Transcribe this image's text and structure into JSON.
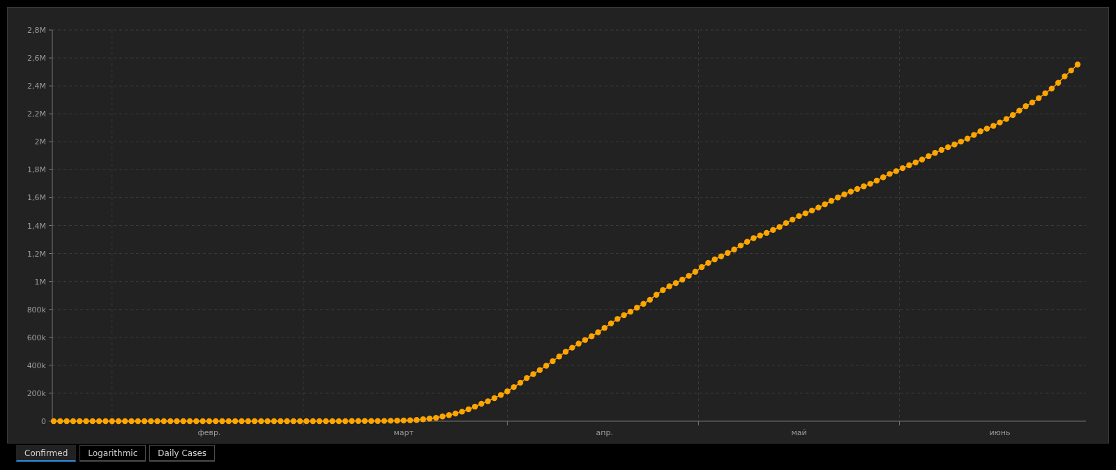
{
  "chart": {
    "chart_data": {
      "type": "line",
      "grid": true,
      "categories": [
        null,
        null,
        null,
        null,
        null,
        null,
        null,
        null,
        null,
        null,
        null,
        null,
        null,
        null,
        null,
        null,
        null,
        null,
        null,
        null,
        null,
        null,
        null,
        null,
        "февр.",
        null,
        null,
        null,
        null,
        null,
        null,
        null,
        null,
        null,
        null,
        null,
        null,
        null,
        null,
        null,
        null,
        null,
        null,
        null,
        null,
        null,
        null,
        null,
        null,
        null,
        null,
        null,
        null,
        null,
        "март",
        null,
        null,
        null,
        null,
        null,
        null,
        null,
        null,
        null,
        null,
        null,
        null,
        null,
        null,
        null,
        null,
        null,
        null,
        null,
        null,
        null,
        null,
        null,
        null,
        null,
        null,
        null,
        null,
        null,
        null,
        "апр.",
        null,
        null,
        null,
        null,
        null,
        null,
        null,
        null,
        null,
        null,
        null,
        null,
        null,
        null,
        null,
        null,
        null,
        null,
        null,
        null,
        null,
        null,
        null,
        null,
        null,
        null,
        null,
        null,
        null,
        "май",
        null,
        null,
        null,
        null,
        null,
        null,
        null,
        null,
        null,
        null,
        null,
        null,
        null,
        null,
        null,
        null,
        null,
        null,
        null,
        null,
        null,
        null,
        null,
        null,
        null,
        null,
        null,
        null,
        null,
        null,
        "июнь",
        null,
        null,
        null,
        null,
        null,
        null,
        null,
        null,
        null,
        null,
        null,
        null
      ],
      "series": [
        {
          "color": "#ffa500",
          "marker": "circle",
          "values": [
            0,
            0,
            0,
            0,
            0,
            0,
            0,
            0,
            0,
            0,
            0,
            0,
            0,
            0,
            0,
            0,
            0,
            0,
            0,
            0,
            0,
            0,
            0,
            0,
            0,
            0,
            0,
            0,
            0,
            0,
            0,
            0,
            0,
            0,
            0,
            0,
            0,
            0,
            0,
            0,
            0,
            0,
            0,
            0,
            0,
            0,
            1000,
            1000,
            1000,
            1000,
            1000,
            2000,
            3000,
            4000,
            5000,
            6000,
            9000,
            14000,
            19000,
            24000,
            34000,
            44000,
            55000,
            68000,
            85000,
            104000,
            125000,
            143000,
            165000,
            188000,
            213000,
            244000,
            275000,
            309000,
            337000,
            366000,
            397000,
            429000,
            463000,
            497000,
            526000,
            555000,
            581000,
            608000,
            636000,
            668000,
            700000,
            732000,
            759000,
            784000,
            812000,
            840000,
            869000,
            905000,
            938000,
            966000,
            988000,
            1013000,
            1040000,
            1069000,
            1103000,
            1133000,
            1158000,
            1180000,
            1204000,
            1229000,
            1257000,
            1284000,
            1310000,
            1329000,
            1348000,
            1369000,
            1390000,
            1418000,
            1443000,
            1468000,
            1487000,
            1508000,
            1529000,
            1552000,
            1577000,
            1601000,
            1623000,
            1643000,
            1662000,
            1681000,
            1699000,
            1722000,
            1746000,
            1770000,
            1790000,
            1811000,
            1832000,
            1852000,
            1873000,
            1897000,
            1920000,
            1942000,
            1961000,
            1980000,
            2001000,
            2023000,
            2049000,
            2075000,
            2094000,
            2114000,
            2138000,
            2163000,
            2191000,
            2223000,
            2255000,
            2281000,
            2312000,
            2347000,
            2381000,
            2422000,
            2468000,
            2510000,
            2553000
          ]
        }
      ],
      "ylim": [
        0,
        2800000
      ],
      "yticks": [
        {
          "value": 0,
          "label": "0"
        },
        {
          "value": 200000,
          "label": "200k"
        },
        {
          "value": 400000,
          "label": "400k"
        },
        {
          "value": 600000,
          "label": "600k"
        },
        {
          "value": 800000,
          "label": "800k"
        },
        {
          "value": 1000000,
          "label": "1M"
        },
        {
          "value": 1200000,
          "label": "1,2M"
        },
        {
          "value": 1400000,
          "label": "1,4M"
        },
        {
          "value": 1600000,
          "label": "1,6M"
        },
        {
          "value": 1800000,
          "label": "1,8M"
        },
        {
          "value": 2000000,
          "label": "2M"
        },
        {
          "value": 2200000,
          "label": "2,2M"
        },
        {
          "value": 2400000,
          "label": "2,4M"
        },
        {
          "value": 2600000,
          "label": "2,6M"
        },
        {
          "value": 2800000,
          "label": "2,8M"
        }
      ]
    }
  },
  "tabs": [
    {
      "label": "Confirmed",
      "selected": true
    },
    {
      "label": "Logarithmic",
      "selected": false
    },
    {
      "label": "Daily Cases",
      "selected": false
    }
  ]
}
